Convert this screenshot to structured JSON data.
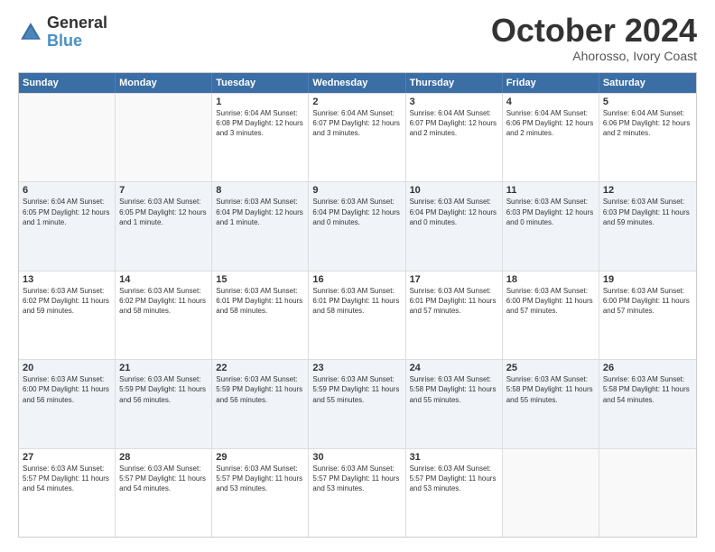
{
  "logo": {
    "line1": "General",
    "line2": "Blue"
  },
  "header": {
    "month": "October 2024",
    "location": "Ahorosso, Ivory Coast"
  },
  "weekdays": [
    "Sunday",
    "Monday",
    "Tuesday",
    "Wednesday",
    "Thursday",
    "Friday",
    "Saturday"
  ],
  "rows": [
    [
      {
        "day": "",
        "text": "",
        "empty": true
      },
      {
        "day": "",
        "text": "",
        "empty": true
      },
      {
        "day": "1",
        "text": "Sunrise: 6:04 AM\nSunset: 6:08 PM\nDaylight: 12 hours\nand 3 minutes."
      },
      {
        "day": "2",
        "text": "Sunrise: 6:04 AM\nSunset: 6:07 PM\nDaylight: 12 hours\nand 3 minutes."
      },
      {
        "day": "3",
        "text": "Sunrise: 6:04 AM\nSunset: 6:07 PM\nDaylight: 12 hours\nand 2 minutes."
      },
      {
        "day": "4",
        "text": "Sunrise: 6:04 AM\nSunset: 6:06 PM\nDaylight: 12 hours\nand 2 minutes."
      },
      {
        "day": "5",
        "text": "Sunrise: 6:04 AM\nSunset: 6:06 PM\nDaylight: 12 hours\nand 2 minutes."
      }
    ],
    [
      {
        "day": "6",
        "text": "Sunrise: 6:04 AM\nSunset: 6:05 PM\nDaylight: 12 hours\nand 1 minute."
      },
      {
        "day": "7",
        "text": "Sunrise: 6:03 AM\nSunset: 6:05 PM\nDaylight: 12 hours\nand 1 minute."
      },
      {
        "day": "8",
        "text": "Sunrise: 6:03 AM\nSunset: 6:04 PM\nDaylight: 12 hours\nand 1 minute."
      },
      {
        "day": "9",
        "text": "Sunrise: 6:03 AM\nSunset: 6:04 PM\nDaylight: 12 hours\nand 0 minutes."
      },
      {
        "day": "10",
        "text": "Sunrise: 6:03 AM\nSunset: 6:04 PM\nDaylight: 12 hours\nand 0 minutes."
      },
      {
        "day": "11",
        "text": "Sunrise: 6:03 AM\nSunset: 6:03 PM\nDaylight: 12 hours\nand 0 minutes."
      },
      {
        "day": "12",
        "text": "Sunrise: 6:03 AM\nSunset: 6:03 PM\nDaylight: 11 hours\nand 59 minutes."
      }
    ],
    [
      {
        "day": "13",
        "text": "Sunrise: 6:03 AM\nSunset: 6:02 PM\nDaylight: 11 hours\nand 59 minutes."
      },
      {
        "day": "14",
        "text": "Sunrise: 6:03 AM\nSunset: 6:02 PM\nDaylight: 11 hours\nand 58 minutes."
      },
      {
        "day": "15",
        "text": "Sunrise: 6:03 AM\nSunset: 6:01 PM\nDaylight: 11 hours\nand 58 minutes."
      },
      {
        "day": "16",
        "text": "Sunrise: 6:03 AM\nSunset: 6:01 PM\nDaylight: 11 hours\nand 58 minutes."
      },
      {
        "day": "17",
        "text": "Sunrise: 6:03 AM\nSunset: 6:01 PM\nDaylight: 11 hours\nand 57 minutes."
      },
      {
        "day": "18",
        "text": "Sunrise: 6:03 AM\nSunset: 6:00 PM\nDaylight: 11 hours\nand 57 minutes."
      },
      {
        "day": "19",
        "text": "Sunrise: 6:03 AM\nSunset: 6:00 PM\nDaylight: 11 hours\nand 57 minutes."
      }
    ],
    [
      {
        "day": "20",
        "text": "Sunrise: 6:03 AM\nSunset: 6:00 PM\nDaylight: 11 hours\nand 56 minutes."
      },
      {
        "day": "21",
        "text": "Sunrise: 6:03 AM\nSunset: 5:59 PM\nDaylight: 11 hours\nand 56 minutes."
      },
      {
        "day": "22",
        "text": "Sunrise: 6:03 AM\nSunset: 5:59 PM\nDaylight: 11 hours\nand 56 minutes."
      },
      {
        "day": "23",
        "text": "Sunrise: 6:03 AM\nSunset: 5:59 PM\nDaylight: 11 hours\nand 55 minutes."
      },
      {
        "day": "24",
        "text": "Sunrise: 6:03 AM\nSunset: 5:58 PM\nDaylight: 11 hours\nand 55 minutes."
      },
      {
        "day": "25",
        "text": "Sunrise: 6:03 AM\nSunset: 5:58 PM\nDaylight: 11 hours\nand 55 minutes."
      },
      {
        "day": "26",
        "text": "Sunrise: 6:03 AM\nSunset: 5:58 PM\nDaylight: 11 hours\nand 54 minutes."
      }
    ],
    [
      {
        "day": "27",
        "text": "Sunrise: 6:03 AM\nSunset: 5:57 PM\nDaylight: 11 hours\nand 54 minutes."
      },
      {
        "day": "28",
        "text": "Sunrise: 6:03 AM\nSunset: 5:57 PM\nDaylight: 11 hours\nand 54 minutes."
      },
      {
        "day": "29",
        "text": "Sunrise: 6:03 AM\nSunset: 5:57 PM\nDaylight: 11 hours\nand 53 minutes."
      },
      {
        "day": "30",
        "text": "Sunrise: 6:03 AM\nSunset: 5:57 PM\nDaylight: 11 hours\nand 53 minutes."
      },
      {
        "day": "31",
        "text": "Sunrise: 6:03 AM\nSunset: 5:57 PM\nDaylight: 11 hours\nand 53 minutes."
      },
      {
        "day": "",
        "text": "",
        "empty": true
      },
      {
        "day": "",
        "text": "",
        "empty": true
      }
    ]
  ]
}
